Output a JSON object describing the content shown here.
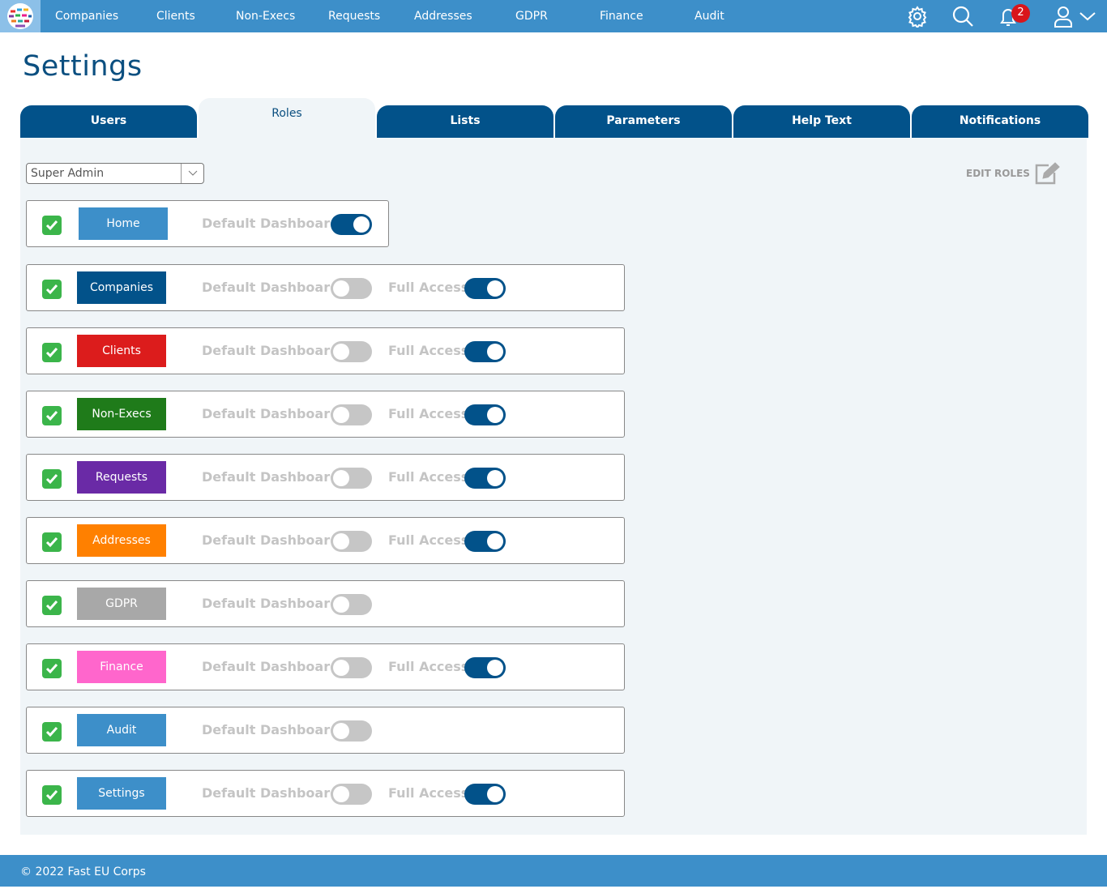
{
  "nav": {
    "items": [
      "Companies",
      "Clients",
      "Non-Execs",
      "Requests",
      "Addresses",
      "GDPR",
      "Finance",
      "Audit"
    ],
    "notification_count": "2"
  },
  "page": {
    "title": "Settings"
  },
  "tabs": [
    {
      "label": "Users"
    },
    {
      "label": "Roles",
      "active": true
    },
    {
      "label": "Lists"
    },
    {
      "label": "Parameters"
    },
    {
      "label": "Help Text"
    },
    {
      "label": "Notifications"
    }
  ],
  "role_select": {
    "value": "Super Admin"
  },
  "edit_roles_label": "EDIT ROLES",
  "toggle_labels": {
    "default_dashboard": "Default Dashboard",
    "full_access": "Full Access"
  },
  "modules": [
    {
      "label": "Home",
      "color": "#3d8fc9",
      "checked": true,
      "default_dashboard": true,
      "full_access": null
    },
    {
      "label": "Companies",
      "color": "#02528a",
      "checked": true,
      "default_dashboard": false,
      "full_access": true
    },
    {
      "label": "Clients",
      "color": "#dc1c1c",
      "checked": true,
      "default_dashboard": false,
      "full_access": true
    },
    {
      "label": "Non-Execs",
      "color": "#1f7b1a",
      "checked": true,
      "default_dashboard": false,
      "full_access": true
    },
    {
      "label": "Requests",
      "color": "#6a2aa6",
      "checked": true,
      "default_dashboard": false,
      "full_access": true
    },
    {
      "label": "Addresses",
      "color": "#ff8000",
      "checked": true,
      "default_dashboard": false,
      "full_access": true
    },
    {
      "label": "GDPR",
      "color": "#a8a8a8",
      "checked": true,
      "default_dashboard": false,
      "full_access": null
    },
    {
      "label": "Finance",
      "color": "#ff66cc",
      "checked": true,
      "default_dashboard": false,
      "full_access": true
    },
    {
      "label": "Audit",
      "color": "#3d8fc9",
      "checked": true,
      "default_dashboard": false,
      "full_access": null
    },
    {
      "label": "Settings",
      "color": "#3d8fc9",
      "checked": true,
      "default_dashboard": false,
      "full_access": true
    }
  ],
  "footer": {
    "text": "© 2022 Fast EU Corps"
  }
}
